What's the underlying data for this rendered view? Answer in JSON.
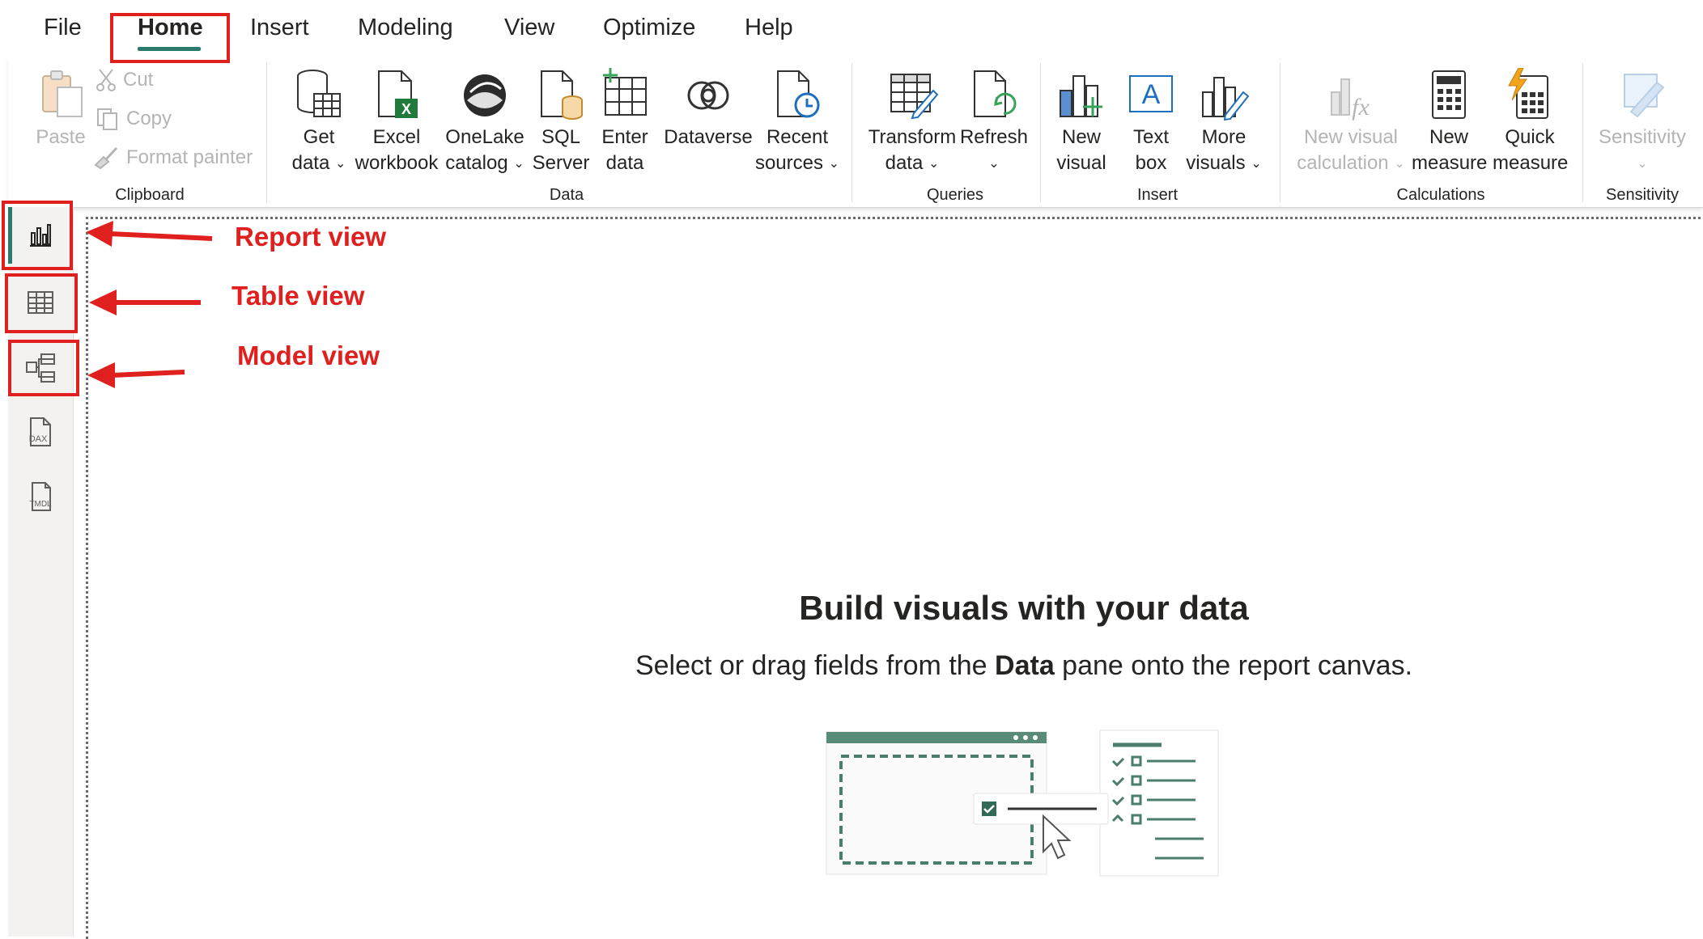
{
  "menu": {
    "tabs": [
      {
        "label": "File"
      },
      {
        "label": "Home"
      },
      {
        "label": "Insert"
      },
      {
        "label": "Modeling"
      },
      {
        "label": "View"
      },
      {
        "label": "Optimize"
      },
      {
        "label": "Help"
      }
    ],
    "active_tab": "Home"
  },
  "ribbon": {
    "clipboard": {
      "label": "Clipboard",
      "paste": "Paste",
      "cut": "Cut",
      "copy": "Copy",
      "format_painter": "Format painter"
    },
    "data": {
      "label": "Data",
      "get_data": [
        "Get",
        "data"
      ],
      "excel": [
        "Excel",
        "workbook"
      ],
      "onelake": [
        "OneLake",
        "catalog"
      ],
      "sql": [
        "SQL",
        "Server"
      ],
      "enter": [
        "Enter",
        "data"
      ],
      "dataverse": "Dataverse",
      "recent": [
        "Recent",
        "sources"
      ]
    },
    "queries": {
      "label": "Queries",
      "transform": [
        "Transform",
        "data"
      ],
      "refresh": "Refresh"
    },
    "insert": {
      "label": "Insert",
      "new_visual": [
        "New",
        "visual"
      ],
      "text_box": [
        "Text",
        "box"
      ],
      "more_visuals": [
        "More",
        "visuals"
      ]
    },
    "calculations": {
      "label": "Calculations",
      "new_visual_calc": [
        "New visual",
        "calculation"
      ],
      "new_measure": [
        "New",
        "measure"
      ],
      "quick_measure": [
        "Quick",
        "measure"
      ]
    },
    "sensitivity": {
      "label": "Sensitivity",
      "button": "Sensitivity"
    }
  },
  "rail": {
    "items": [
      "report-view",
      "table-view",
      "model-view",
      "dax-query-view",
      "tmdl-view"
    ],
    "dax_text": "DAX",
    "tmdl_text": "TMDL"
  },
  "annotations": {
    "report_view": "Report view",
    "table_view": "Table view",
    "model_view": "Model view"
  },
  "canvas": {
    "title": "Build visuals with your data",
    "subtitle_pre": "Select or drag fields from the ",
    "subtitle_bold": "Data",
    "subtitle_post": " pane onto the report canvas."
  },
  "colors": {
    "accent": "#2b7a6e",
    "annotation_red": "#e0201f",
    "disabled_text": "#b4b4b4",
    "rail_bg": "#f3f2f1"
  }
}
